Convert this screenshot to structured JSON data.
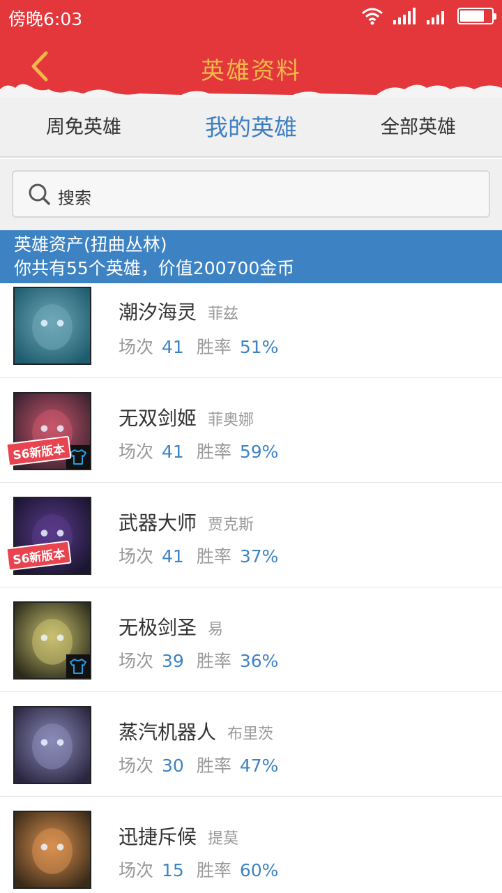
{
  "status_bar": {
    "time": "傍晚6:03"
  },
  "header": {
    "title": "英雄资料"
  },
  "tabs": [
    {
      "label": "周免英雄",
      "active": false
    },
    {
      "label": "我的英雄",
      "active": true
    },
    {
      "label": "全部英雄",
      "active": false
    }
  ],
  "search": {
    "placeholder": "搜索"
  },
  "banner": {
    "line1": "英雄资产(扭曲丛林)",
    "line2": "你共有55个英雄，价值200700金币"
  },
  "stat_labels": {
    "games": "场次",
    "winrate": "胜率"
  },
  "s6_badge": "S6新版本",
  "heroes": [
    {
      "name": "潮汐海灵",
      "title": "菲兹",
      "games": "41",
      "winrate": "51%",
      "skin": false,
      "s6": false,
      "icon": "fizz-portrait",
      "colors": [
        "#1d5c6e",
        "#6fa8b8"
      ]
    },
    {
      "name": "无双剑姬",
      "title": "菲奥娜",
      "games": "41",
      "winrate": "59%",
      "skin": true,
      "s6": true,
      "icon": "fiora-portrait",
      "colors": [
        "#3a2230",
        "#c8566c"
      ]
    },
    {
      "name": "武器大师",
      "title": "贾克斯",
      "games": "41",
      "winrate": "37%",
      "skin": false,
      "s6": true,
      "icon": "jax-portrait",
      "colors": [
        "#1a1530",
        "#5a3a8a"
      ]
    },
    {
      "name": "无极剑圣",
      "title": "易",
      "games": "39",
      "winrate": "36%",
      "skin": true,
      "s6": false,
      "icon": "masteryi-portrait",
      "colors": [
        "#2a2a1a",
        "#c8c070"
      ]
    },
    {
      "name": "蒸汽机器人",
      "title": "布里茨",
      "games": "30",
      "winrate": "47%",
      "skin": false,
      "s6": false,
      "icon": "blitzcrank-portrait",
      "colors": [
        "#2a2540",
        "#8a8ab8"
      ]
    },
    {
      "name": "迅捷斥候",
      "title": "提莫",
      "games": "15",
      "winrate": "60%",
      "skin": false,
      "s6": false,
      "icon": "teemo-portrait",
      "colors": [
        "#3a2a18",
        "#d89050"
      ]
    }
  ]
}
